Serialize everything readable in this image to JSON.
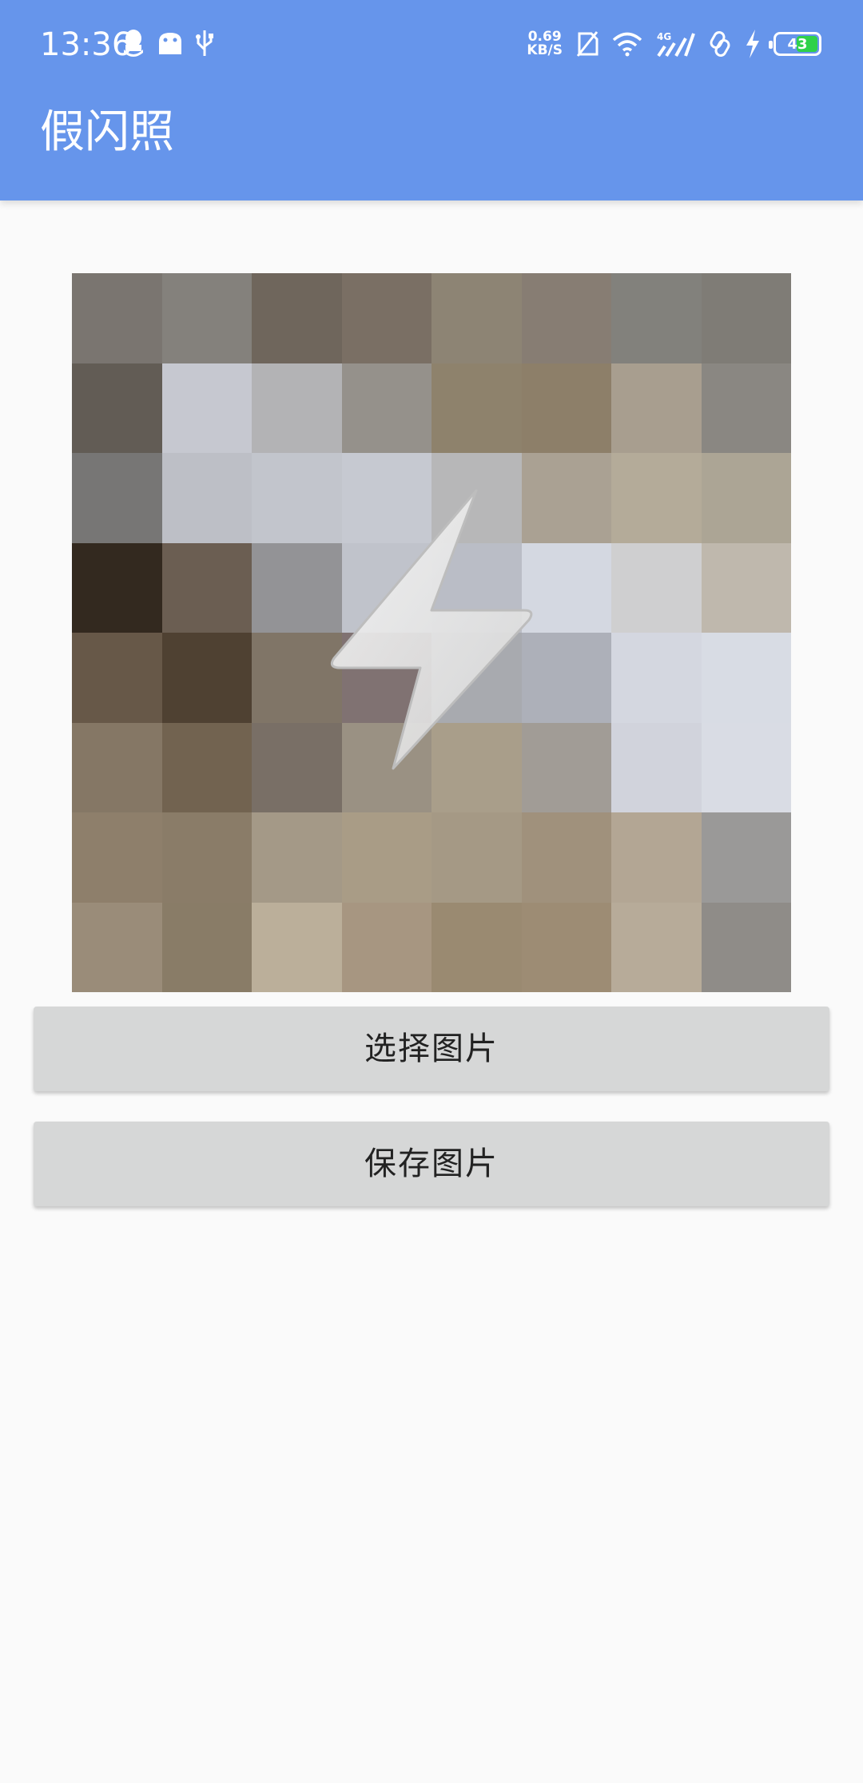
{
  "status_bar": {
    "time": "13:36",
    "left_icons": [
      "qq-icon",
      "android-icon",
      "usb-icon"
    ],
    "net_speed_value": "0.69",
    "net_speed_unit": "KB/S",
    "network_type": "4G",
    "battery_level": "43",
    "battery_color": "#2fd14a"
  },
  "app_bar": {
    "title": "假闪照",
    "color": "#6695eb"
  },
  "preview": {
    "icon": "flash-icon",
    "tiles": [
      [
        "#7a7570",
        "#84817c",
        "#6f665c",
        "#7a6f64",
        "#8d8474",
        "#877d73",
        "#82817c",
        "#7f7c76"
      ],
      [
        "#625c55",
        "#c6c8d0",
        "#b3b3b5",
        "#95918b",
        "#8e826c",
        "#8d7f69",
        "#a89e8f",
        "#8a8782"
      ],
      [
        "#777675",
        "#bdbfc6",
        "#c2c5cc",
        "#c6c9d1",
        "#b7b7b8",
        "#aaa193",
        "#b4ab99",
        "#aca595"
      ],
      [
        "#33291f",
        "#6b5e52",
        "#939396",
        "#c0c3cb",
        "#babdc6",
        "#d4d8e1",
        "#cfcfd0",
        "#bfb8ad"
      ],
      [
        "#675848",
        "#4f4132",
        "#807567",
        "#807272",
        "#a8aaaf",
        "#adb0b9",
        "#d4d7e0",
        "#d8dce4"
      ],
      [
        "#857765",
        "#726350",
        "#796f66",
        "#9a9183",
        "#a99e8a",
        "#a19c96",
        "#d1d3dc",
        "#d9dce4"
      ],
      [
        "#8e7f6b",
        "#8a7c68",
        "#a49987",
        "#a99c86",
        "#a59985",
        "#a0917c",
        "#b3a694",
        "#9a9998"
      ],
      [
        "#9a8c79",
        "#897c67",
        "#bbaf9a",
        "#a79681",
        "#9a8a71",
        "#9d8c74",
        "#b7ab99",
        "#8f8c88"
      ]
    ]
  },
  "buttons": {
    "select_label": "选择图片",
    "save_label": "保存图片"
  }
}
